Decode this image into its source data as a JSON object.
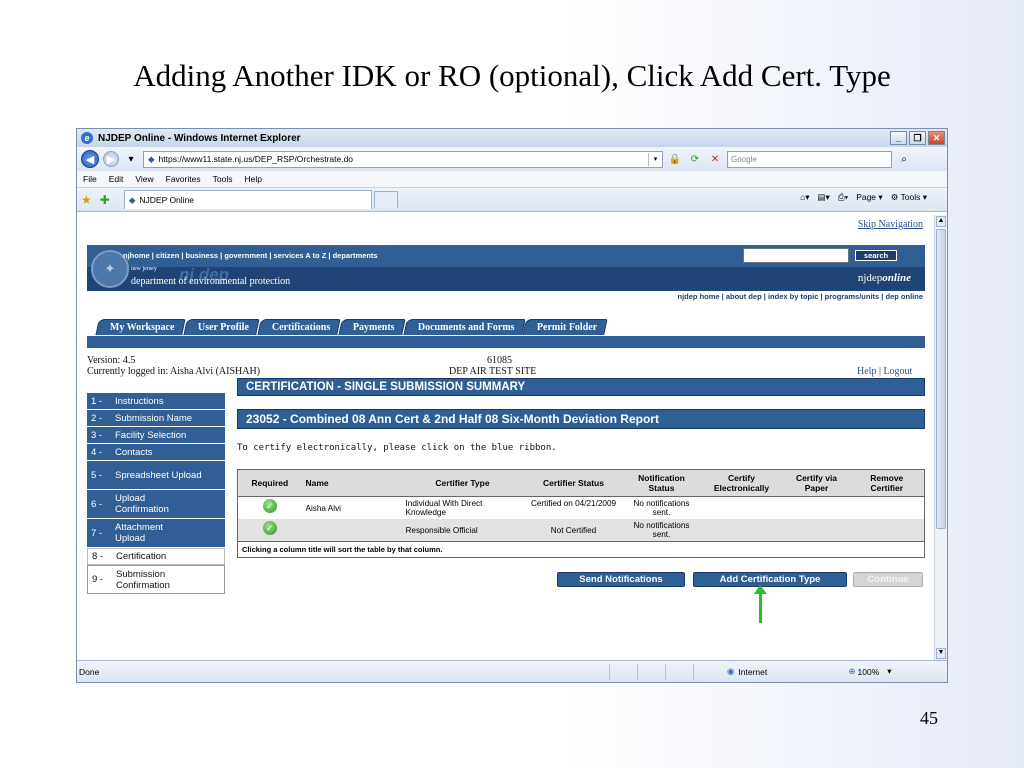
{
  "slide": {
    "title": "Adding Another IDK or RO (optional), Click Add Cert. Type",
    "page_number": "45"
  },
  "browser": {
    "window_title": "NJDEP Online - Windows Internet Explorer",
    "url": "https://www11.state.nj.us/DEP_RSP/Orchestrate.do",
    "search_placeholder": "Google",
    "menu": [
      "File",
      "Edit",
      "View",
      "Favorites",
      "Tools",
      "Help"
    ],
    "tab_label": "NJDEP Online",
    "cmd_page": "Page",
    "cmd_tools": "Tools",
    "status_text": "Done",
    "zone": "Internet",
    "zoom": "100%"
  },
  "site": {
    "skip": "Skip Navigation",
    "topnav": "njhome | citizen | business | government | services A to Z | departments",
    "search_btn": "search",
    "newjersey": "new jersey",
    "logo": "nj dep",
    "dept": "department of environmental protection",
    "online_prefix": "njdep",
    "online_suffix": "online",
    "subnav": "njdep home | about dep | index by topic | programs/units | dep online",
    "tabs": [
      "My Workspace",
      "User Profile",
      "Certifications",
      "Payments",
      "Documents and Forms",
      "Permit Folder"
    ],
    "version": "Version: 4.5",
    "logged_in": "Currently logged in: Aisha Alvi (AISHAH)",
    "facility_id": "61085",
    "facility_name": "DEP AIR TEST SITE",
    "help_logout": "Help | Logout"
  },
  "steps": [
    {
      "n": "1 -",
      "label": "Instructions"
    },
    {
      "n": "2 -",
      "label": "Submission Name"
    },
    {
      "n": "3 -",
      "label": "Facility Selection"
    },
    {
      "n": "4 -",
      "label": "Contacts"
    },
    {
      "n": "5 -",
      "label": "Spreadsheet Upload"
    },
    {
      "n": "6 -",
      "label": "Upload Confirmation"
    },
    {
      "n": "7 -",
      "label": "Attachment Upload"
    },
    {
      "n": "8 -",
      "label": "Certification"
    },
    {
      "n": "9 -",
      "label": "Submission Confirmation"
    }
  ],
  "main": {
    "summary_title": "CERTIFICATION - SINGLE SUBMISSION SUMMARY",
    "report_title": "23052 - Combined 08 Ann Cert & 2nd Half 08 Six-Month Deviation Report",
    "instruction": "To certify electronically, please click on the blue ribbon.",
    "columns": [
      "Required",
      "Name",
      "Certifier Type",
      "Certifier Status",
      "Notification Status",
      "Certify Electronically",
      "Certify via Paper",
      "Remove Certifier"
    ],
    "rows": [
      {
        "name": "Aisha Alvi",
        "type": "Individual With Direct Knowledge",
        "status": "Certified on 04/21/2009",
        "notif": "No notifications sent."
      },
      {
        "name": "",
        "type": "Responsible Official",
        "status": "Not Certified",
        "notif": "No notifications sent."
      }
    ],
    "sort_note": "Clicking a column title will sort the table by that column.",
    "btn_send": "Send Notifications",
    "btn_add": "Add Certification Type",
    "btn_continue": "Continue"
  }
}
